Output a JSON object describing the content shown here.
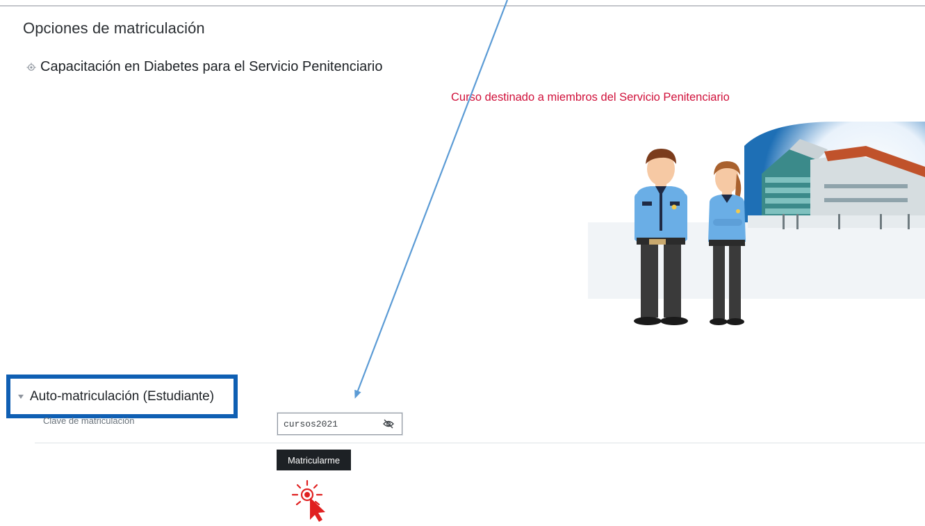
{
  "page": {
    "heading": "Opciones de matriculación"
  },
  "course": {
    "icon": "course-icon",
    "name": "Capacitación en Diabetes para el Servicio Penitenciario",
    "summary_text": "Curso destinado a miembros del Servicio Penitenciario",
    "summary_color": "#d0103a"
  },
  "self_enrolment": {
    "caret_icon": "caret-down-icon",
    "title": "Auto-matriculación (Estudiante)",
    "highlight_color": "#0f5fb3",
    "key_label": "Clave de matriculación",
    "key_value": "cursos2021",
    "reveal_icon": "eye-slash-icon",
    "button_label": "Matricularme",
    "button_color": "#1d2125"
  },
  "annotations": {
    "arrow_color": "#5b9bd5",
    "click_indicator_icon": "click-cursor-icon",
    "click_indicator_color": "#e02020"
  }
}
